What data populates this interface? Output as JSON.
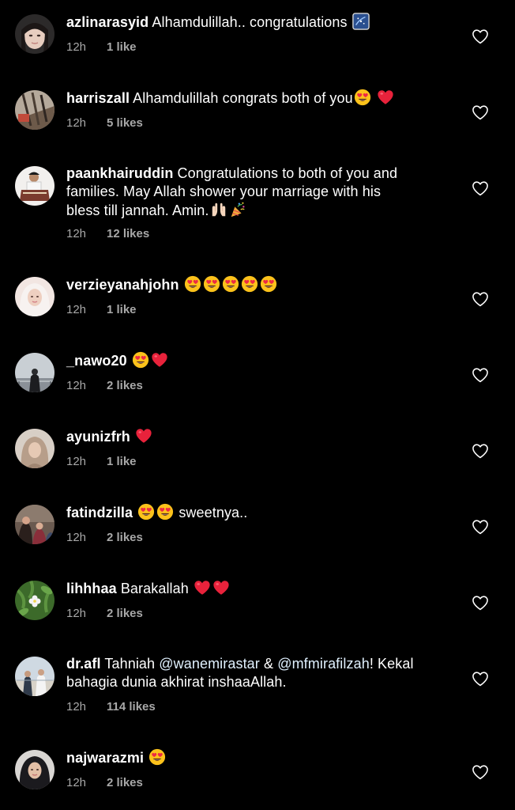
{
  "comments": [
    {
      "username": "azlinarasyid",
      "text": "Alhamdulillah.. congratulations",
      "time": "12h",
      "likes": "1 like",
      "avatar": "avatar-woman-icon"
    },
    {
      "username": "harriszall",
      "text": "Alhamdulillah congrats both of you",
      "time": "12h",
      "likes": "5 likes",
      "avatar": "avatar-photo-icon"
    },
    {
      "username": "paankhairuddin",
      "text_line1": "Congratulations to both of you and",
      "text_line2": "families. May Allah shower your marriage with his",
      "text_line3": "bless till jannah. Amin.",
      "time": "12h",
      "likes": "12 likes",
      "avatar": "avatar-man-icon"
    },
    {
      "username": "verzieyanahjohn",
      "time": "12h",
      "likes": "1 like",
      "avatar": "avatar-hijab-icon"
    },
    {
      "username": "_nawo20",
      "time": "12h",
      "likes": "2 likes",
      "avatar": "avatar-scenery-icon"
    },
    {
      "username": "ayunizfrh",
      "time": "12h",
      "likes": "1 like",
      "avatar": "avatar-hijab-beige-icon"
    },
    {
      "username": "fatindzilla",
      "text": "sweetnya..",
      "time": "12h",
      "likes": "2 likes",
      "avatar": "avatar-group-icon"
    },
    {
      "username": "lihhhaa",
      "text": "Barakallah",
      "time": "12h",
      "likes": "2 likes",
      "avatar": "avatar-flower-icon"
    },
    {
      "username": "dr.afl",
      "text_pre": "Tahniah",
      "mention1": "@wanemirastar",
      "text_mid": "&",
      "mention2": "@mfmirafilzah",
      "text_post": "! Kekal",
      "text_line2": "bahagia dunia akhirat inshaaAllah.",
      "time": "12h",
      "likes": "114 likes",
      "avatar": "avatar-outdoor-icon"
    },
    {
      "username": "najwarazmi",
      "time": "12h",
      "likes": "2 likes",
      "avatar": "avatar-hijab-dark-icon"
    }
  ],
  "colors": {
    "background": "#000000",
    "text": "#ffffff",
    "meta": "#a8a8a8",
    "heart_outline": "#ffffff",
    "emoji_heart": "#e8223b"
  },
  "icons": {
    "like": "heart-outline-icon",
    "emoji_heart_eyes": "heart-eyes-emoji-icon",
    "emoji_red_heart": "red-heart-emoji-icon",
    "emoji_sparkle": "sparkle-emoji-icon",
    "emoji_hands": "raised-hands-emoji-icon",
    "emoji_party": "party-popper-emoji-icon"
  }
}
